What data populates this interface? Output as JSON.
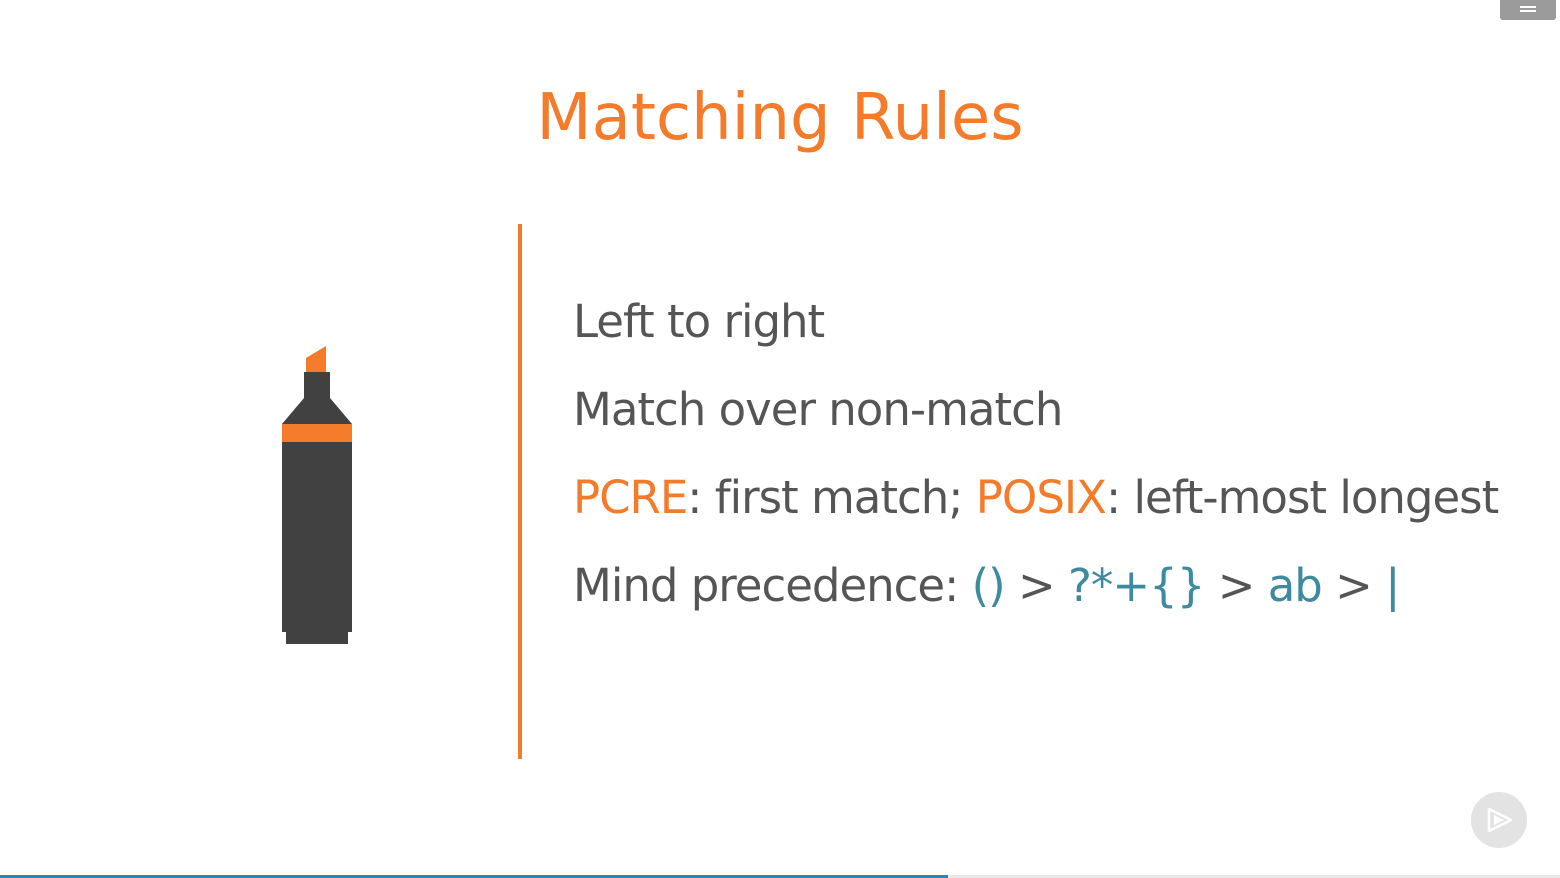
{
  "slide": {
    "title": "Matching Rules",
    "bullets": {
      "b1": "Left to right",
      "b2": "Match over non-match",
      "b3": {
        "pcre": "PCRE",
        "pcre_rest": ": first match; ",
        "posix": "POSIX",
        "posix_rest": ": left-most longest"
      },
      "b4": {
        "label": "Mind precedence: ",
        "groups": "()",
        "gt1": " > ",
        "quantifiers": "?*+{}",
        "gt2": " > ",
        "sequence": "ab",
        "gt3": " > ",
        "alternation": "|"
      }
    }
  },
  "icons": {
    "marker": "highlighter-marker-icon",
    "menu": "menu-icon",
    "player": "pluralsight-play-icon"
  },
  "colors": {
    "accent": "#f37b2a",
    "text": "#555555",
    "code": "#3e8a9e",
    "marker_body": "#414141",
    "progress": "#2a86b8"
  },
  "player": {
    "progress": 0.608
  }
}
